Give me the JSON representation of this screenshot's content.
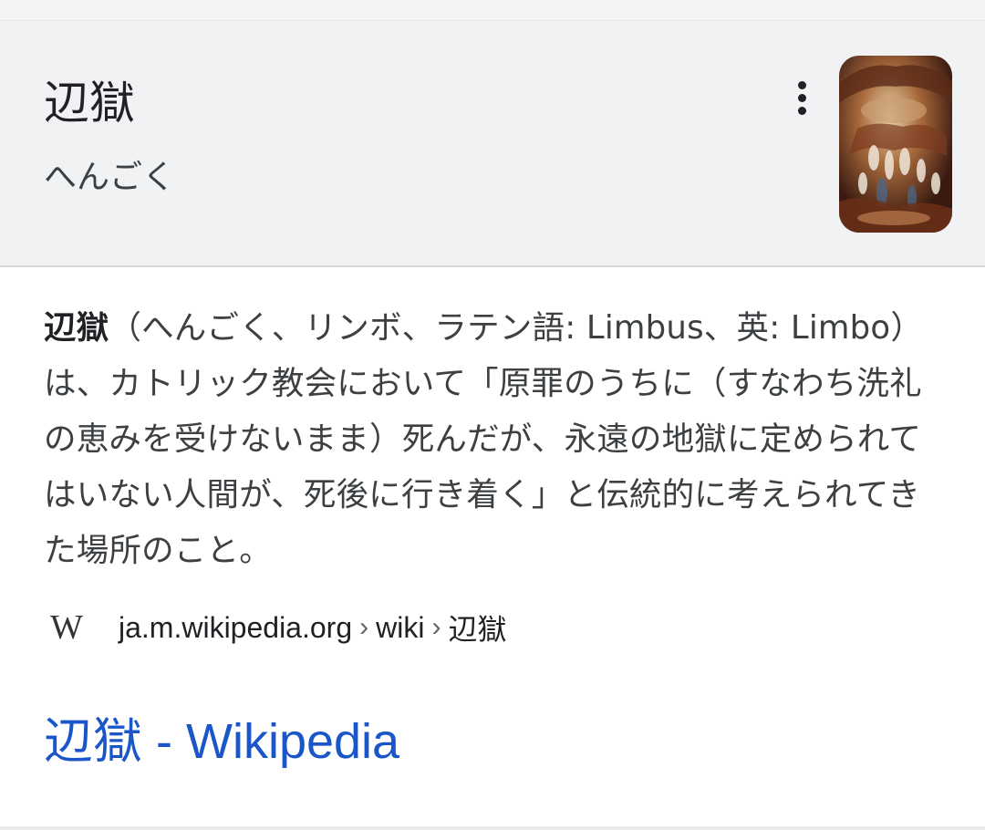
{
  "entity": {
    "title": "辺獄",
    "reading": "へんごく",
    "more_icon": "more-vert-icon",
    "thumbnail_icon": "painting-thumbnail"
  },
  "description": {
    "term": "辺獄",
    "text": "（へんごく、リンボ、ラテン語: Limbus、英: Limbo）は、カトリック教会において「原罪のうちに（すなわち洗礼の恵みを受けないまま）死んだが、永遠の地獄に定められてはいない人間が、死後に行き着く」と伝統的に考えられてきた場所のこと。"
  },
  "source": {
    "logo": "W",
    "domain": "ja.m.wikipedia.org",
    "sep1": "›",
    "path1": "wiki",
    "sep2": "›",
    "path2": "辺獄"
  },
  "link": {
    "label": "辺獄 - Wikipedia"
  }
}
